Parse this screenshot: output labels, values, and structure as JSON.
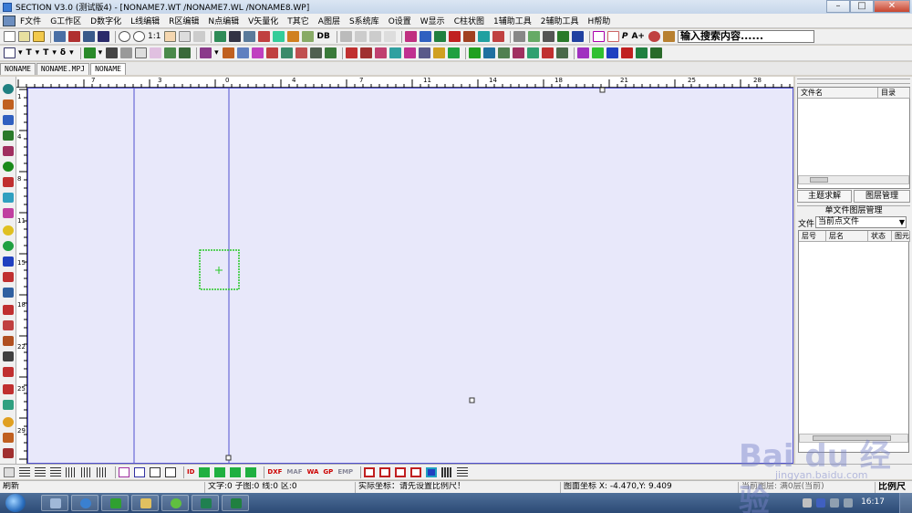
{
  "window": {
    "title": "SECTION V3.0 (测试版4) - [NONAME7.WT /NONAME7.WL /NONAME8.WP]",
    "minimize": "–",
    "maximize": "□",
    "close": "✕"
  },
  "menu": [
    "F文件",
    "G工作区",
    "D数字化",
    "L线编辑",
    "R区编辑",
    "N点编辑",
    "V矢量化",
    "T其它",
    "A图层",
    "S系统库",
    "O设置",
    "W显示",
    "C柱状图",
    "1辅助工具",
    "2辅助工具",
    "H帮助"
  ],
  "toolbar1": {
    "zoom_ratio": "1:1",
    "db_label": "DB",
    "p_label": "P",
    "text_label": "A+",
    "search_value": "输入搜索内容......"
  },
  "toolbar2": {
    "t_label": "T",
    "t2_label": "T",
    "delta_label": "δ"
  },
  "doc_tabs": [
    "NONAME",
    "NONAME.MPJ",
    "NONAME"
  ],
  "ruler": {
    "h_labels": [
      "7",
      "3",
      "0",
      "4",
      "7",
      "11",
      "14",
      "18",
      "21",
      "25",
      "28"
    ],
    "v_labels": [
      "1",
      "4",
      "8",
      "11",
      "15",
      "18",
      "22",
      "25",
      "29"
    ]
  },
  "right_panel": {
    "file_col": "文件名",
    "dir_col": "目录",
    "btn_topic": "主题求解",
    "btn_layer": "图层管理",
    "layer_title": "单文件图层管理",
    "file_label": "文件",
    "file_select": "当前点文件",
    "cols": [
      "层号",
      "层名",
      "状态",
      "图元"
    ]
  },
  "bottom_toolbar": {
    "id_label": "ID",
    "dxf": "DXF",
    "maf": "MAF",
    "wa": "WA",
    "gp": "GP",
    "emp": "EMP"
  },
  "status": {
    "mode": "刷新",
    "counts": "文字:0 子图:0 线:0 区:0",
    "actual_coord": "实际坐标：请先设置比例尺！",
    "map_coord": "图面坐标 X: -4.470,Y: 9.409",
    "layer_info": "当前图层: 满0层(当前)",
    "scale": "比例尺"
  },
  "taskbar": {
    "time": "16:17"
  },
  "watermark": {
    "text": "Bai du 经验",
    "sub": "jingyan.baidu.com"
  },
  "colors": {
    "canvas_bg": "#e8e8fa",
    "canvas_line": "#5050d0",
    "selection": "#28c828"
  }
}
